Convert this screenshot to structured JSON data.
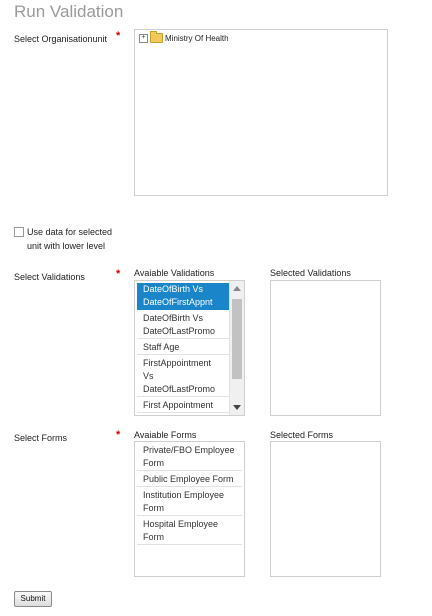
{
  "page": {
    "title": "Run Validation",
    "required_mark": "*"
  },
  "org": {
    "label": "Select Organisationunit",
    "tree_items": [
      {
        "label": "Ministry Of Health",
        "expander": "+"
      }
    ]
  },
  "checkbox": {
    "label": "Use data for selected unit with lower level",
    "checked": false
  },
  "validations": {
    "label": "Select Validations",
    "available_header": "Avaiable Validations",
    "selected_header": "Selected Validations",
    "available": [
      "DateOfBirth Vs DateOfFirstAppnt",
      "DateOfBirth Vs DateOfLastPromo",
      "Staff Age",
      "FirstAppointment Vs DateOfLastPromo",
      "First Appointment"
    ],
    "selected_index": 0,
    "selected": []
  },
  "forms": {
    "label": "Select Forms",
    "available_header": "Avaiable Forms",
    "selected_header": "Selected Forms",
    "available": [
      "Private/FBO Employee Form",
      "Public Employee Form",
      "Institution Employee Form",
      "Hospital Employee Form"
    ],
    "selected": []
  },
  "submit": {
    "label": "Submit"
  }
}
